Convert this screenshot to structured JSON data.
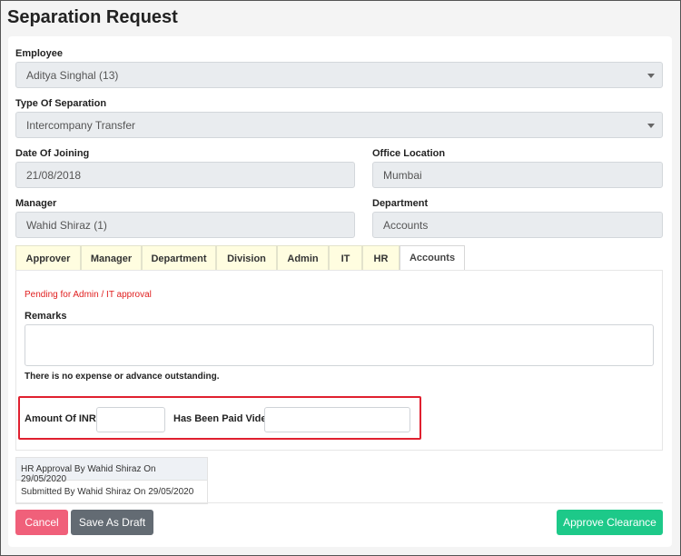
{
  "page": {
    "title": "Separation Request"
  },
  "form": {
    "employee": {
      "label": "Employee",
      "value": "Aditya Singhal (13)"
    },
    "separation_type": {
      "label": "Type Of Separation",
      "value": "Intercompany Transfer"
    },
    "date_of_joining": {
      "label": "Date Of Joining",
      "value": "21/08/2018"
    },
    "office_location": {
      "label": "Office Location",
      "value": "Mumbai"
    },
    "manager": {
      "label": "Manager",
      "value": "Wahid Shiraz (1)"
    },
    "department": {
      "label": "Department",
      "value": "Accounts"
    }
  },
  "tabs": [
    {
      "label": "Approver"
    },
    {
      "label": "Manager"
    },
    {
      "label": "Department"
    },
    {
      "label": "Division"
    },
    {
      "label": "Admin"
    },
    {
      "label": "IT"
    },
    {
      "label": "HR"
    },
    {
      "label": "Accounts",
      "active": true
    }
  ],
  "accounts_tab": {
    "status": "Pending for Admin / IT approval",
    "remarks_label": "Remarks",
    "remarks_value": "",
    "no_expense_note": "There is no expense or advance outstanding.",
    "amount_label": "Amount Of INR",
    "amount_value": "",
    "paid_vide_label": "Has Been Paid Vide",
    "paid_vide_value": ""
  },
  "history": [
    {
      "text": "HR Approval By Wahid Shiraz On 29/05/2020"
    },
    {
      "text": "Submitted By Wahid Shiraz On 29/05/2020"
    }
  ],
  "actions": {
    "cancel": "Cancel",
    "save_draft": "Save As Draft",
    "approve": "Approve Clearance"
  },
  "colors": {
    "cancel": "#f0607a",
    "save_draft": "#636b73",
    "approve": "#1dc989",
    "status_text": "#e02020",
    "highlight_border": "#e0202f",
    "tab_bg": "#fffde0"
  }
}
